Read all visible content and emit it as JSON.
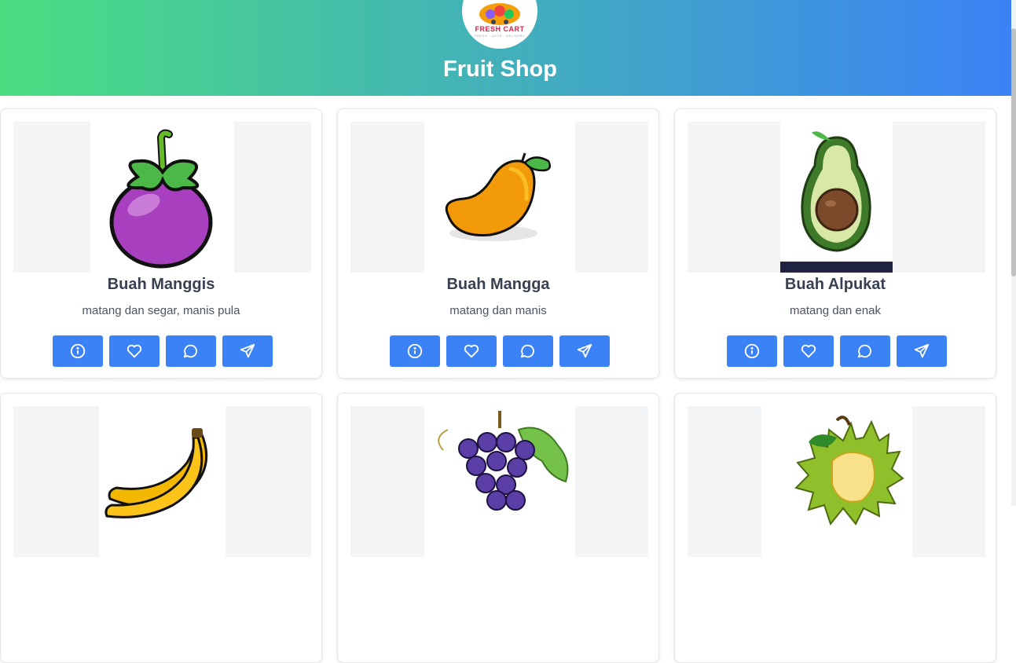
{
  "header": {
    "title": "Fruit Shop",
    "logo_text": "FRESH CART",
    "logo_subtext": "FRESH · JUICE · DELIVERY"
  },
  "colors": {
    "accent": "#3b82f6",
    "gradient_start": "#4ade80",
    "gradient_end": "#3b82f6"
  },
  "products": [
    {
      "name": "Buah Manggis",
      "description": "matang dan segar, manis pula",
      "image_icon": "mangosteen-icon"
    },
    {
      "name": "Buah Mangga",
      "description": "matang dan manis",
      "image_icon": "mango-icon"
    },
    {
      "name": "Buah Alpukat",
      "description": "matang dan enak",
      "image_icon": "avocado-icon",
      "watermark": "VectorStock"
    },
    {
      "image_icon": "banana-icon"
    },
    {
      "image_icon": "grapes-icon"
    },
    {
      "image_icon": "durian-icon"
    }
  ],
  "actions": [
    "info-icon",
    "heart-icon",
    "comment-icon",
    "send-icon"
  ]
}
